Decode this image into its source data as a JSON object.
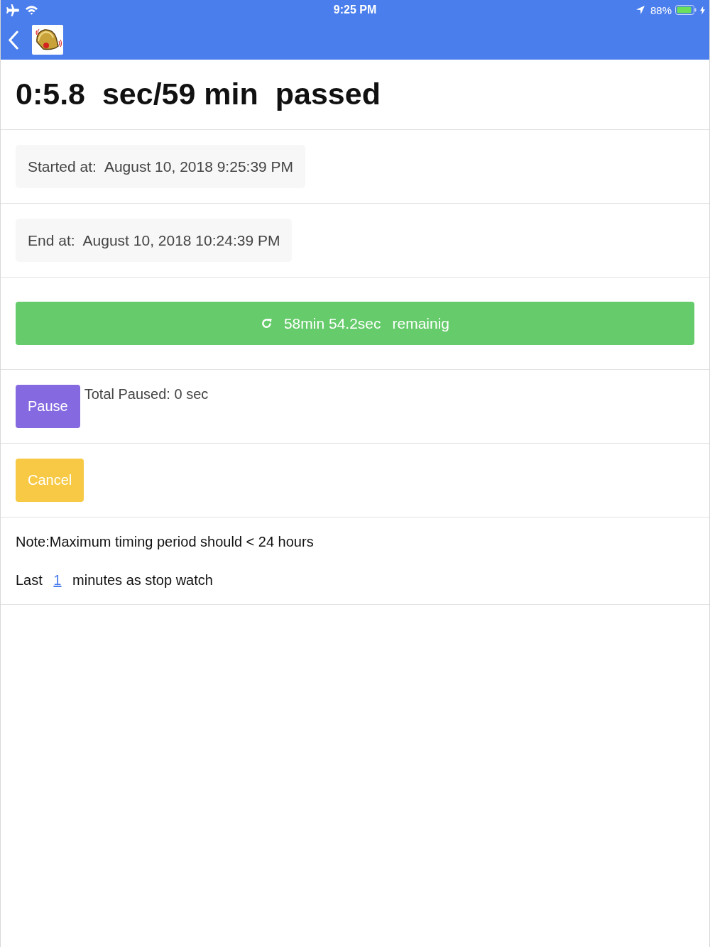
{
  "status_bar": {
    "time": "9:25 PM",
    "battery_percent": "88%"
  },
  "title": "0:5.8  sec/59 min  passed",
  "started": {
    "label": "Started at:",
    "value": "August 10, 2018 9:25:39 PM"
  },
  "end": {
    "label": "End at:",
    "value": "August 10, 2018 10:24:39 PM"
  },
  "remaining_button": {
    "duration": "58min 54.2sec",
    "label": "remainig"
  },
  "pause": {
    "button": "Pause",
    "total_paused": "Total Paused: 0 sec"
  },
  "cancel_button": "Cancel",
  "note": "Note:Maximum timing period should < 24 hours",
  "stopwatch": {
    "before": "Last",
    "link": "1",
    "after": "minutes as stop watch"
  }
}
